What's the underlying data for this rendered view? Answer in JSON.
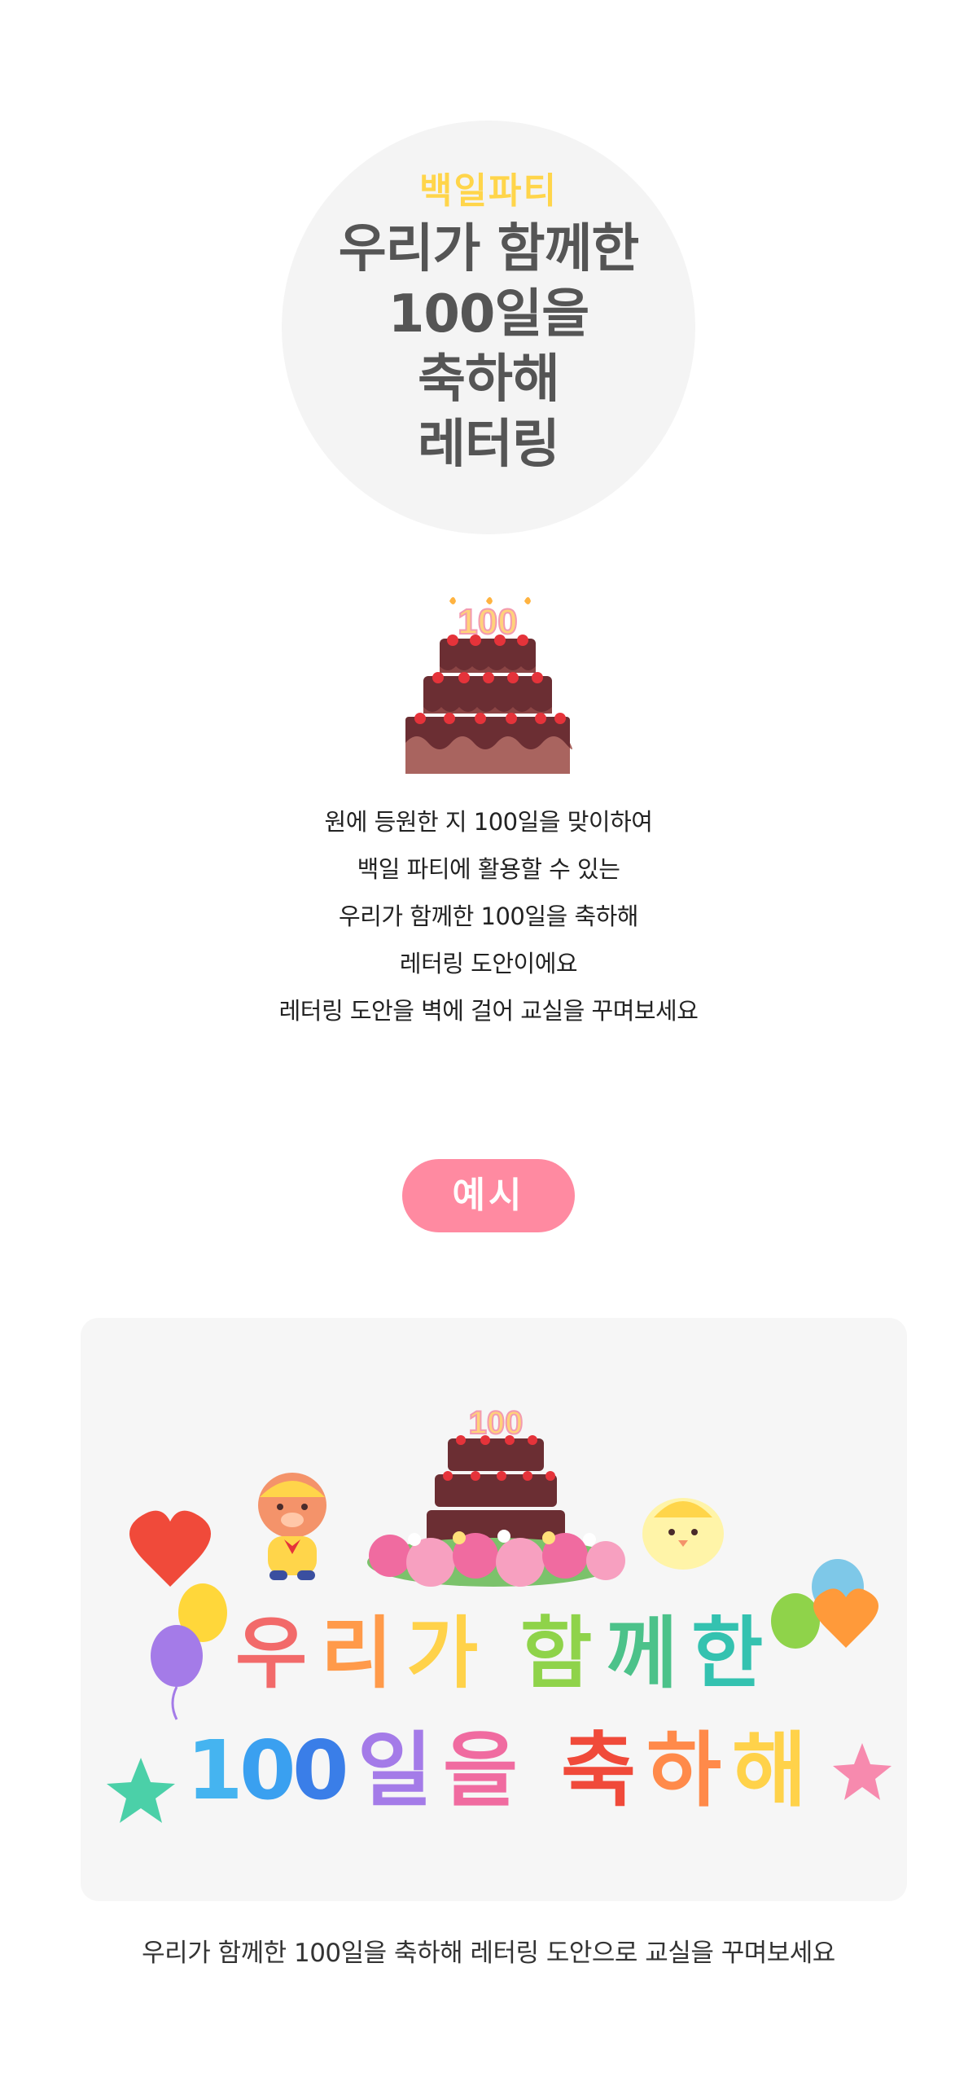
{
  "hero": {
    "subtitle": "백일파티",
    "title_lines": [
      "우리가 함께한",
      "100일을",
      "축하해",
      "레터링"
    ]
  },
  "cake": {
    "candle_text": "100"
  },
  "description": {
    "lines": [
      "원에 등원한 지 100일을 맞이하여",
      "백일 파티에 활용할 수 있는",
      "우리가 함께한 100일을 축하해",
      "레터링 도안이에요",
      "레터링 도안을 벽에 걸어 교실을 꾸며보세요"
    ]
  },
  "example": {
    "label": "예시",
    "lettering": {
      "line1": [
        "우",
        "리",
        "가",
        "함",
        "께",
        "한"
      ],
      "line2": [
        "1",
        "0",
        "0",
        "일",
        "을",
        "축",
        "하",
        "해"
      ]
    },
    "caption": "우리가 함께한 100일을 축하해 레터링 도안으로 교실을 꾸며보세요"
  },
  "colors": {
    "subtitle": "#ffd54a",
    "title": "#555555",
    "pill": "#ff8aa1",
    "card_bg": "#f6f6f6",
    "cake_dark": "#6b2e33",
    "cake_light": "#a9645f",
    "berry": "#e5333a"
  }
}
